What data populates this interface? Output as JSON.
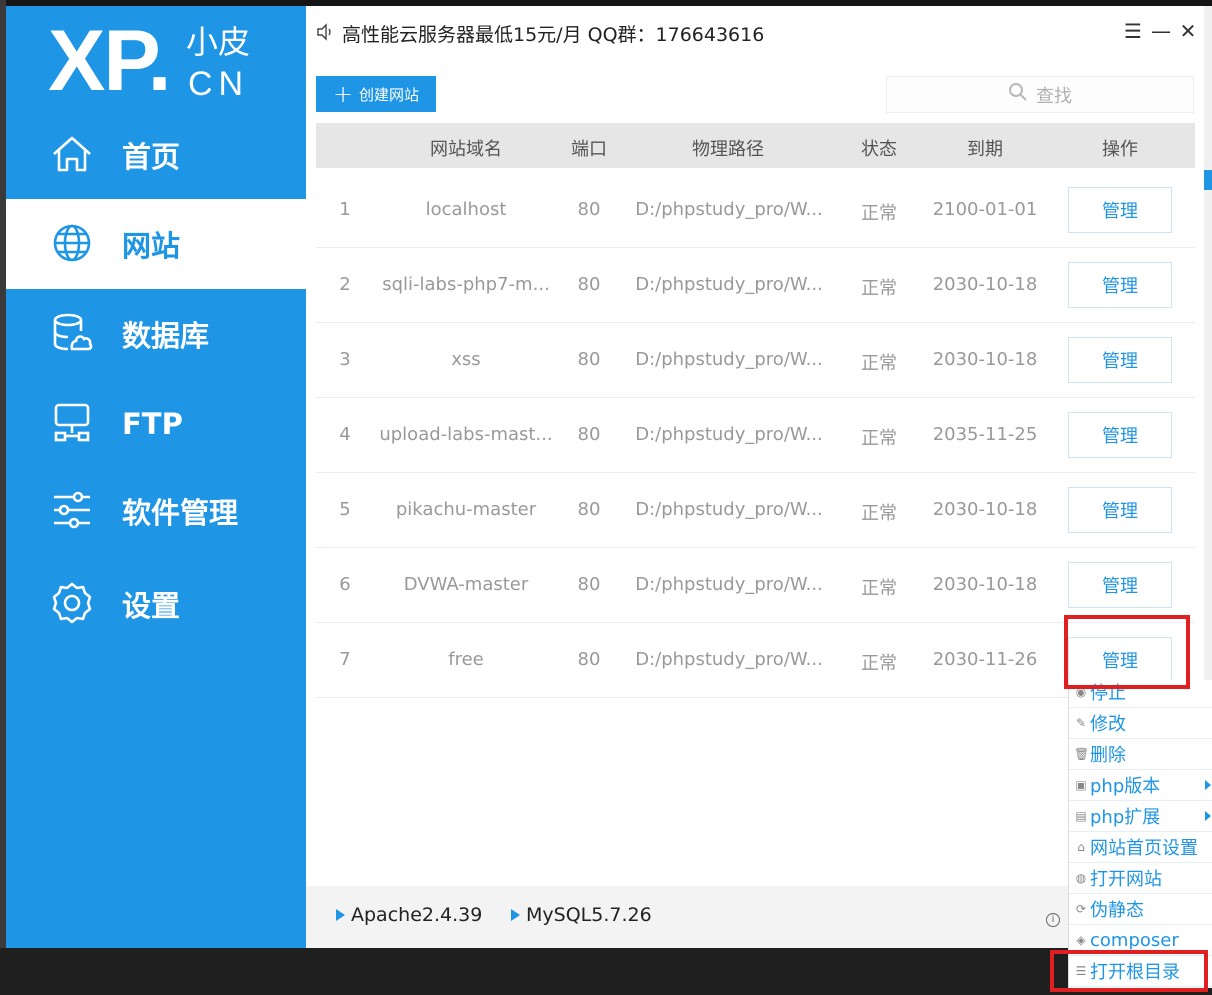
{
  "logo": {
    "xp": "XP.",
    "xiao": "小皮",
    "cn": "CN"
  },
  "sidebar": {
    "items": [
      {
        "label": "首页",
        "icon": "home-icon"
      },
      {
        "label": "网站",
        "icon": "globe-icon",
        "active": true
      },
      {
        "label": "数据库",
        "icon": "database-icon"
      },
      {
        "label": "FTP",
        "icon": "ftp-server-icon"
      },
      {
        "label": "软件管理",
        "icon": "sliders-icon"
      },
      {
        "label": "设置",
        "icon": "gear-icon"
      }
    ]
  },
  "titlebar": {
    "text": "高性能云服务器最低15元/月  QQ群：176643616",
    "menu_glyph": "☰",
    "min_glyph": "—",
    "close_glyph": "✕"
  },
  "toolbar": {
    "create_label": "创建网站",
    "search_placeholder": "查找"
  },
  "table": {
    "headers": [
      "网站域名",
      "端口",
      "物理路径",
      "状态",
      "到期",
      "操作"
    ],
    "rows": [
      {
        "no": "1",
        "domain": "localhost",
        "port": "80",
        "path": "D:/phpstudy_pro/W...",
        "status": "正常",
        "expiry": "2100-01-01",
        "action": "管理"
      },
      {
        "no": "2",
        "domain": "sqli-labs-php7-m...",
        "port": "80",
        "path": "D:/phpstudy_pro/W...",
        "status": "正常",
        "expiry": "2030-10-18",
        "action": "管理"
      },
      {
        "no": "3",
        "domain": "xss",
        "port": "80",
        "path": "D:/phpstudy_pro/W...",
        "status": "正常",
        "expiry": "2030-10-18",
        "action": "管理"
      },
      {
        "no": "4",
        "domain": "upload-labs-mast...",
        "port": "80",
        "path": "D:/phpstudy_pro/W...",
        "status": "正常",
        "expiry": "2035-11-25",
        "action": "管理"
      },
      {
        "no": "5",
        "domain": "pikachu-master",
        "port": "80",
        "path": "D:/phpstudy_pro/W...",
        "status": "正常",
        "expiry": "2030-10-18",
        "action": "管理"
      },
      {
        "no": "6",
        "domain": "DVWA-master",
        "port": "80",
        "path": "D:/phpstudy_pro/W...",
        "status": "正常",
        "expiry": "2030-10-18",
        "action": "管理"
      },
      {
        "no": "7",
        "domain": "free",
        "port": "80",
        "path": "D:/phpstudy_pro/W...",
        "status": "正常",
        "expiry": "2030-11-26",
        "action": "管理"
      }
    ]
  },
  "services": [
    {
      "label": "Apache2.4.39"
    },
    {
      "label": "MySQL5.7.26"
    }
  ],
  "context_menu": {
    "items": [
      {
        "label": "停止",
        "icon": "stop-icon"
      },
      {
        "label": "修改",
        "icon": "pencil-icon"
      },
      {
        "label": "删除",
        "icon": "trash-icon"
      },
      {
        "label": "php版本",
        "icon": "php-version-icon",
        "submenu": true
      },
      {
        "label": "php扩展",
        "icon": "php-extension-icon",
        "submenu": true
      },
      {
        "label": "网站首页设置",
        "icon": "home-icon"
      },
      {
        "label": "打开网站",
        "icon": "globe-icon"
      },
      {
        "label": "伪静态",
        "icon": "rewrite-icon"
      },
      {
        "label": "composer",
        "icon": "composer-icon"
      },
      {
        "label": "打开根目录",
        "icon": "list-icon"
      }
    ]
  },
  "colors": {
    "accent": "#1f95e6",
    "highlight": "#e02020"
  }
}
